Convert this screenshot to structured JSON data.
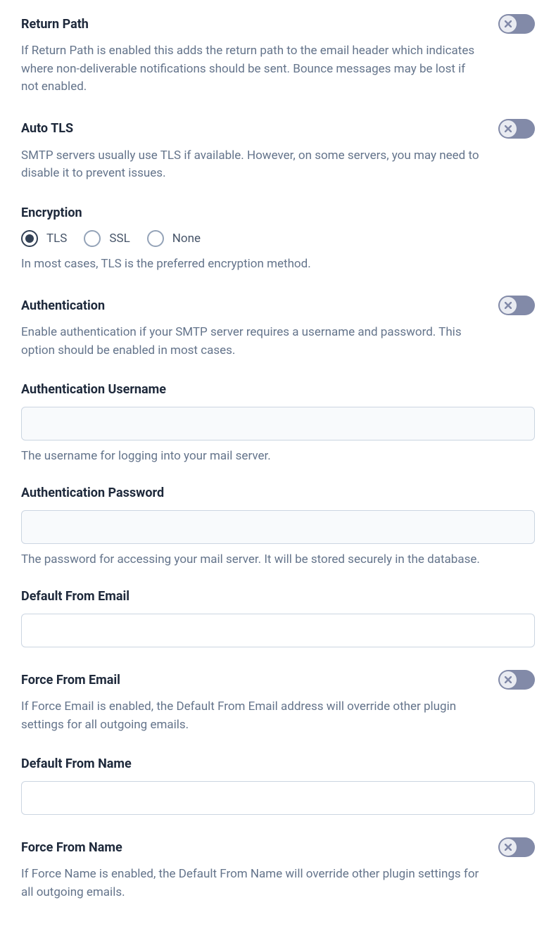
{
  "returnPath": {
    "title": "Return Path",
    "desc": "If Return Path is enabled this adds the return path to the email header which indicates where non-deliverable notifications should be sent. Bounce messages may be lost if not enabled.",
    "enabled": false
  },
  "autoTls": {
    "title": "Auto TLS",
    "desc": "SMTP servers usually use TLS if available. However, on some servers, you may need to disable it to prevent issues.",
    "enabled": false
  },
  "encryption": {
    "title": "Encryption",
    "options": [
      "TLS",
      "SSL",
      "None"
    ],
    "selected": "TLS",
    "helper": "In most cases, TLS is the preferred encryption method."
  },
  "authentication": {
    "title": "Authentication",
    "desc": "Enable authentication if your SMTP server requires a username and password. This option should be enabled in most cases.",
    "enabled": false
  },
  "authUsername": {
    "label": "Authentication Username",
    "value": "",
    "helper": "The username for logging into your mail server."
  },
  "authPassword": {
    "label": "Authentication Password",
    "value": "",
    "helper": "The password for accessing your mail server. It will be stored securely in the database."
  },
  "defaultFromEmail": {
    "label": "Default From Email",
    "value": ""
  },
  "forceFromEmail": {
    "title": "Force From Email",
    "desc": "If Force Email is enabled, the Default From Email address will override other plugin settings for all outgoing emails.",
    "enabled": false
  },
  "defaultFromName": {
    "label": "Default From Name",
    "value": ""
  },
  "forceFromName": {
    "title": "Force From Name",
    "desc": "If Force Name is enabled, the Default From Name will override other plugin settings for all outgoing emails.",
    "enabled": false
  }
}
